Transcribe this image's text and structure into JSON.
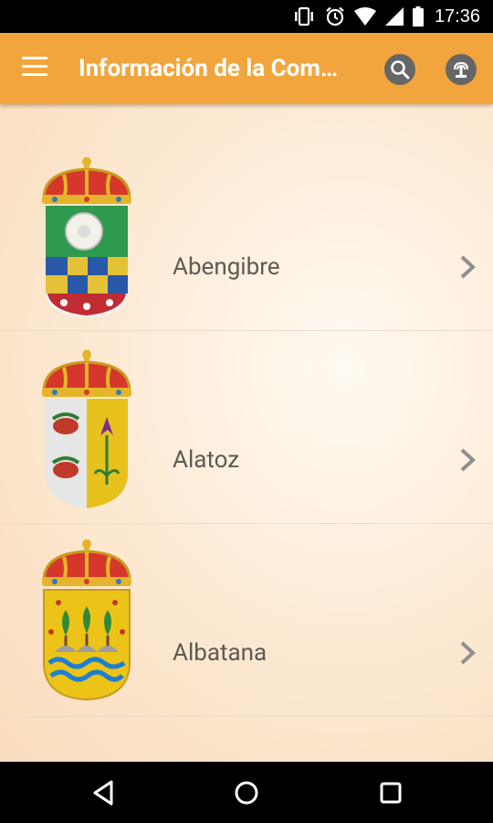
{
  "status_bar": {
    "time": "17:36",
    "icons": [
      "vibrate-icon",
      "alarm-icon",
      "wifi-icon",
      "cell-signal-icon",
      "battery-icon"
    ]
  },
  "app_bar": {
    "title": "Información de la Com…",
    "color": "#f2a53c",
    "actions": [
      "search-icon",
      "fountain-icon"
    ]
  },
  "list": {
    "items": [
      {
        "label": "Abengibre",
        "icon": "abengibre-coat-of-arms-icon"
      },
      {
        "label": "Alatoz",
        "icon": "alatoz-coat-of-arms-icon"
      },
      {
        "label": "Albatana",
        "icon": "albatana-coat-of-arms-icon"
      }
    ]
  },
  "nav_bar": {
    "buttons": [
      "back-icon",
      "home-icon",
      "recents-icon"
    ]
  }
}
